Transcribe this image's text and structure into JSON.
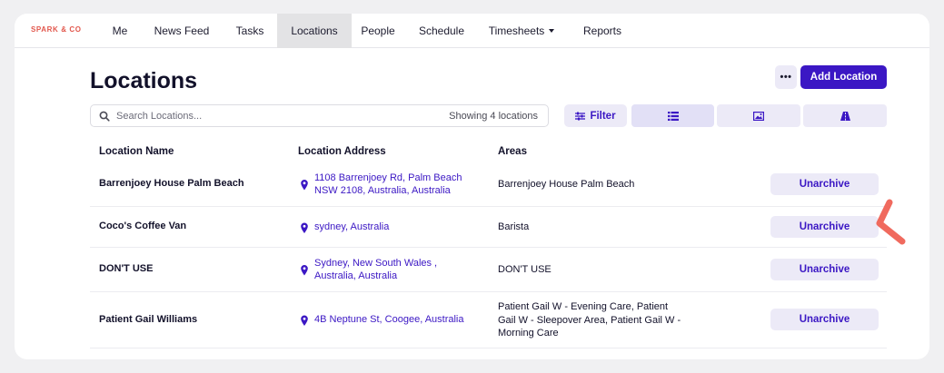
{
  "brand": "SPARK & CO",
  "nav": {
    "items": [
      {
        "label": "Me"
      },
      {
        "label": "News Feed"
      },
      {
        "label": "Tasks"
      },
      {
        "label": "Locations"
      },
      {
        "label": "People"
      },
      {
        "label": "Schedule"
      },
      {
        "label": "Timesheets"
      },
      {
        "label": "Reports"
      }
    ],
    "active": "Locations"
  },
  "page": {
    "title": "Locations",
    "more_label": "•••",
    "add_label": "Add Location"
  },
  "search": {
    "placeholder": "Search Locations...",
    "value": "",
    "count_text": "Showing 4 locations"
  },
  "filter_label": "Filter",
  "view_modes": [
    "list-icon",
    "image-icon",
    "map-icon"
  ],
  "table": {
    "headers": [
      "Location Name",
      "Location Address",
      "Areas"
    ],
    "rows": [
      {
        "name": "Barrenjoey House Palm Beach",
        "address_1": "1108 Barrenjoey Rd, Palm Beach",
        "address_2": "NSW 2108, Australia, Australia",
        "areas": "Barrenjoey House Palm Beach",
        "action": "Unarchive"
      },
      {
        "name": "Coco's Coffee Van",
        "address_1": "sydney, Australia",
        "address_2": "",
        "areas": "Barista",
        "action": "Unarchive"
      },
      {
        "name": "DON'T USE",
        "address_1": "Sydney, New South Wales ,",
        "address_2": "Australia, Australia",
        "areas": "DON'T USE",
        "action": "Unarchive"
      },
      {
        "name": "Patient Gail Williams",
        "address_1": "4B Neptune St, Coogee, Australia",
        "address_2": "",
        "areas": "Patient Gail W - Evening Care, Patient Gail W - Sleepover Area, Patient Gail W - Morning Care",
        "action": "Unarchive"
      }
    ]
  },
  "colors": {
    "accent": "#3b17c4",
    "accent_soft": "#eceaf7",
    "brand": "#e2574c",
    "pointer": "#f06a5e"
  }
}
